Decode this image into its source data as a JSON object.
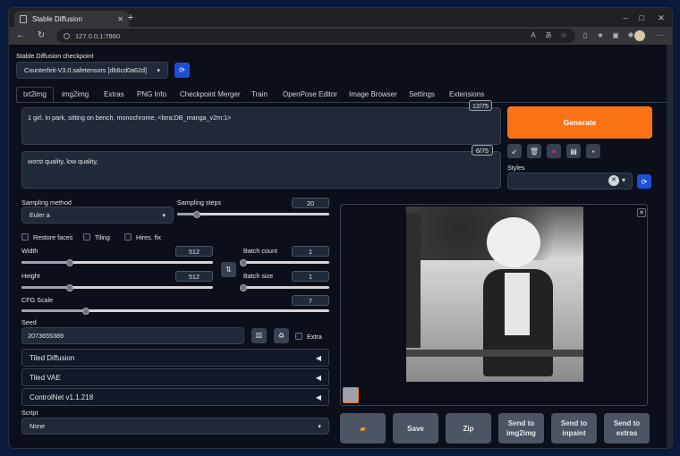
{
  "browser": {
    "tab_title": "Stable Diffusion",
    "url": "127.0.0.1:7860"
  },
  "checkpoint": {
    "label": "Stable Diffusion checkpoint",
    "value": "Counterfeit-V3.0.safetensors [db6cd0a62d]"
  },
  "tabs": [
    "txt2img",
    "img2img",
    "Extras",
    "PNG Info",
    "Checkpoint Merger",
    "Train",
    "OpenPose Editor",
    "Image Browser",
    "Settings",
    "Extensions"
  ],
  "prompt": {
    "value": "1 girl, in park, sitting on bench,  monochrome, <lora:DB_manga_v2m:1>",
    "tokens": "12/75"
  },
  "negative": {
    "value": "worst quality,  low quality,",
    "tokens": "6/75"
  },
  "generate_label": "Generate",
  "styles_label": "Styles",
  "sampling": {
    "method_label": "Sampling method",
    "method": "Euler a",
    "steps_label": "Sampling steps",
    "steps": "20",
    "steps_frac": 0.13
  },
  "checks": {
    "restore": "Restore faces",
    "tiling": "Tiling",
    "hires": "Hires. fix"
  },
  "width": {
    "label": "Width",
    "value": "512",
    "frac": 0.25
  },
  "height": {
    "label": "Height",
    "value": "512",
    "frac": 0.25
  },
  "batch_count": {
    "label": "Batch count",
    "value": "1",
    "frac": 0.0
  },
  "batch_size": {
    "label": "Batch size",
    "value": "1",
    "frac": 0.0
  },
  "cfg": {
    "label": "CFG Scale",
    "value": "7",
    "frac": 0.21
  },
  "seed": {
    "label": "Seed",
    "value": "2073655389",
    "extra": "Extra"
  },
  "accordions": [
    "Tiled Diffusion",
    "Tiled VAE",
    "ControlNet v1.1.218"
  ],
  "script": {
    "label": "Script",
    "value": "None"
  },
  "actions": {
    "save": "Save",
    "zip": "Zip",
    "img2img": "Send to\nimg2img",
    "inpaint": "Send to\ninpaint",
    "extras": "Send to\nextras"
  },
  "colors": {
    "accent": "#f97316",
    "tab_bg": "#0b0f19"
  }
}
